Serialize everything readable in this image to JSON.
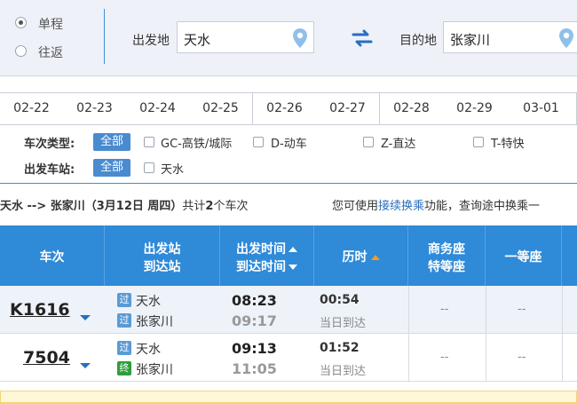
{
  "trip_type": {
    "options": [
      {
        "label": "单程",
        "checked": true
      },
      {
        "label": "往返",
        "checked": false
      }
    ]
  },
  "from": {
    "label": "出发地",
    "value": "天水",
    "icon": "location-pin-icon"
  },
  "swap_icon": "swap-arrows-icon",
  "to": {
    "label": "目的地",
    "value": "张家川",
    "icon": "location-pin-icon"
  },
  "dates": [
    "02-22",
    "02-23",
    "02-24",
    "02-25",
    "02-26",
    "02-27",
    "02-28",
    "02-29",
    "03-01"
  ],
  "filters": {
    "train_type_label": "车次类型:",
    "all_label": "全部",
    "train_types": [
      "GC-高铁/城际",
      "D-动车",
      "Z-直达",
      "T-特快"
    ],
    "station_label": "出发车站:",
    "stations": [
      "天水"
    ]
  },
  "summary": {
    "route": "天水 --> 张家川（3月12日  周四）",
    "count_prefix": "共计",
    "count": "2",
    "count_suffix": "个车次"
  },
  "hint": {
    "prefix": "您可使用",
    "link": "接续换乘",
    "suffix": "功能，查询途中换乘一"
  },
  "table": {
    "headers": {
      "train": "车次",
      "station_line1": "出发站",
      "station_line2": "到达站",
      "time_line1": "出发时间",
      "time_line2": "到达时间",
      "duration": "历时",
      "business_line1": "商务座",
      "business_line2": "特等座",
      "first_class": "一等座"
    },
    "rows": [
      {
        "train_no": "K1616",
        "from_badge": "过",
        "from_station": "天水",
        "to_badge": "过",
        "to_station": "张家川",
        "depart": "08:23",
        "arrive": "09:17",
        "duration": "00:54",
        "arrive_day": "当日到达",
        "business": "--",
        "first_class": "--"
      },
      {
        "train_no": "7504",
        "from_badge": "过",
        "from_station": "天水",
        "to_badge": "终",
        "to_station": "张家川",
        "depart": "09:13",
        "arrive": "11:05",
        "duration": "01:52",
        "arrive_day": "当日到达",
        "business": "--",
        "first_class": "--"
      }
    ]
  },
  "colors": {
    "header_blue": "#2f8ad8",
    "link_blue": "#2a6ec0",
    "sort_orange": "#f59a23",
    "terminal_badge_green": "#2e9e3a"
  }
}
